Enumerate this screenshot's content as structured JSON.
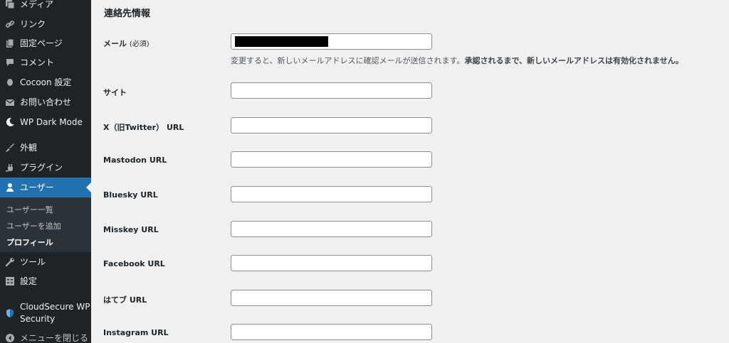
{
  "sidebar": {
    "items": [
      {
        "label": "メディア",
        "icon": "media-icon"
      },
      {
        "label": "リンク",
        "icon": "link-icon"
      },
      {
        "label": "固定ページ",
        "icon": "page-icon"
      },
      {
        "label": "コメント",
        "icon": "comment-icon"
      },
      {
        "label": "Cocoon 設定",
        "icon": "cocoon-icon"
      },
      {
        "label": "お問い合わせ",
        "icon": "mail-icon"
      },
      {
        "label": "WP Dark Mode",
        "icon": "moon-icon"
      },
      {
        "label": "外観",
        "icon": "brush-icon"
      },
      {
        "label": "プラグイン",
        "icon": "plugin-icon"
      },
      {
        "label": "ユーザー",
        "icon": "user-icon"
      },
      {
        "label": "ツール",
        "icon": "wrench-icon"
      },
      {
        "label": "設定",
        "icon": "settings-icon"
      },
      {
        "label": "CloudSecure WP Security",
        "icon": "shield-icon"
      },
      {
        "label": "メニューを閉じる",
        "icon": "collapse-icon"
      }
    ],
    "submenu": [
      {
        "label": "ユーザー一覧"
      },
      {
        "label": "ユーザーを追加"
      },
      {
        "label": "プロフィール"
      }
    ],
    "active_color": "#2271b1"
  },
  "main": {
    "section_title": "連絡先情報",
    "email": {
      "label": "メール",
      "required": "(必須)",
      "desc_normal": "変更すると、新しいメールアドレスに確認メールが送信されます。",
      "desc_bold": "承認されるまで、新しいメールアドレスは有効化されません。"
    },
    "fields": [
      {
        "label": "サイト",
        "value": ""
      },
      {
        "label": "X（旧Twitter） URL",
        "value": ""
      },
      {
        "label": "Mastodon URL",
        "value": ""
      },
      {
        "label": "Bluesky URL",
        "value": ""
      },
      {
        "label": "Misskey URL",
        "value": ""
      },
      {
        "label": "Facebook URL",
        "value": ""
      },
      {
        "label": "はてブ URL",
        "value": ""
      },
      {
        "label": "Instagram URL",
        "value": ""
      }
    ]
  }
}
